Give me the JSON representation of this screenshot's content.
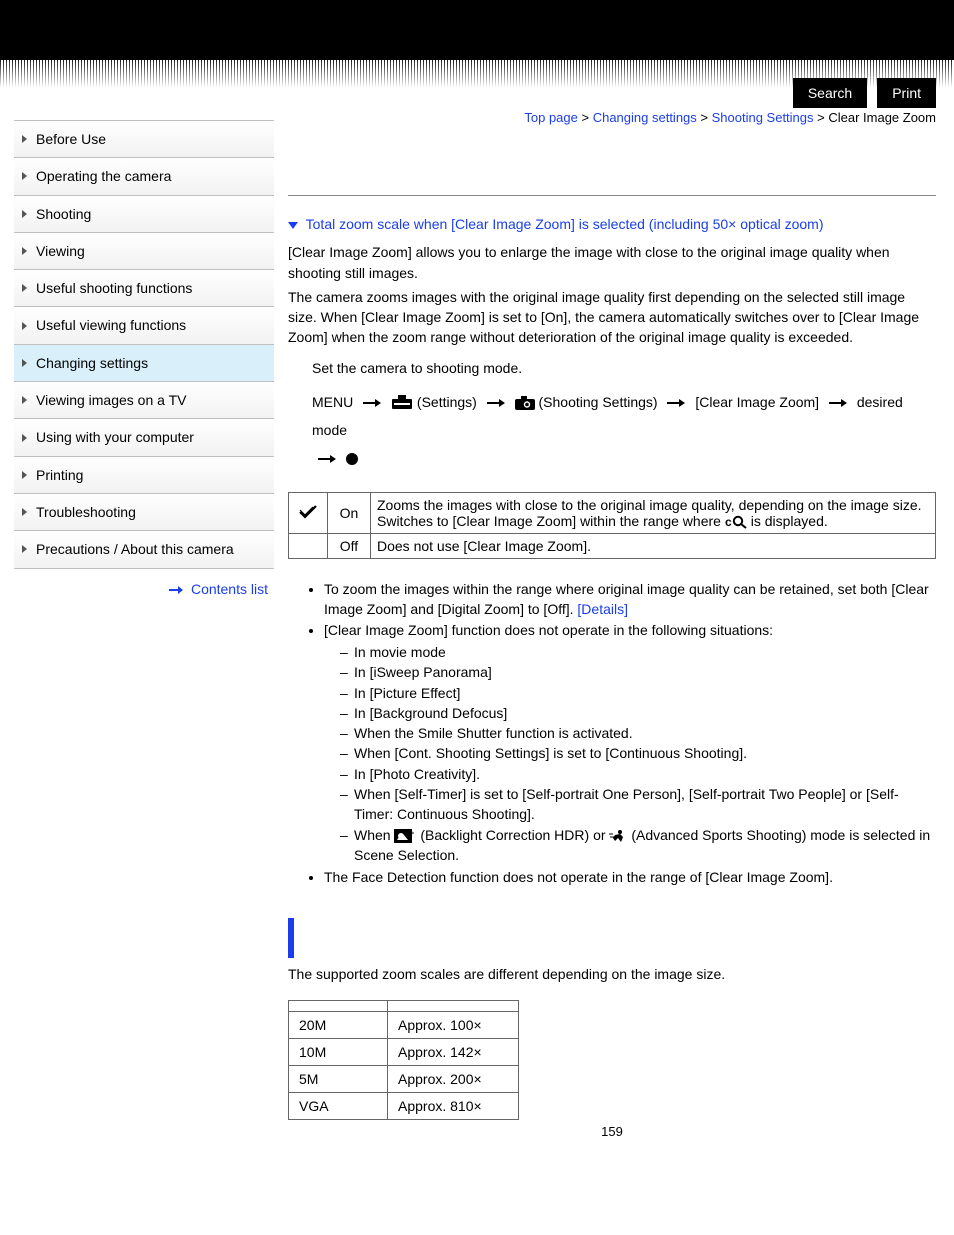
{
  "top_buttons": {
    "search": "Search",
    "print": "Print"
  },
  "sidebar": {
    "items": [
      {
        "label": "Before Use"
      },
      {
        "label": "Operating the camera"
      },
      {
        "label": "Shooting"
      },
      {
        "label": "Viewing"
      },
      {
        "label": "Useful shooting functions"
      },
      {
        "label": "Useful viewing functions"
      },
      {
        "label": "Changing settings",
        "active": true
      },
      {
        "label": "Viewing images on a TV"
      },
      {
        "label": "Using with your computer"
      },
      {
        "label": "Printing"
      },
      {
        "label": "Troubleshooting"
      },
      {
        "label": "Precautions / About this camera"
      }
    ],
    "contents_link": "Contents list"
  },
  "breadcrumb": {
    "top": "Top page",
    "l1": "Changing settings",
    "l2": "Shooting Settings",
    "current": "Clear Image Zoom",
    "sep": " > "
  },
  "anchor_heading": "Total zoom scale when [Clear Image Zoom] is selected (including 50× optical zoom)",
  "intro": {
    "p1": "[Clear Image Zoom] allows you to enlarge the image with close to the original image quality when shooting still images.",
    "p2": "The camera zooms images with the original image quality first depending on the selected still image size. When [Clear Image Zoom] is set to [On], the camera automatically switches over to [Clear Image Zoom] when the zoom range without deterioration of the original image quality is exceeded."
  },
  "steps": {
    "s1": "Set the camera to shooting mode.",
    "menu": "MENU",
    "settings": "(Settings)",
    "shooting": "(Shooting Settings)",
    "ciz": "[Clear Image Zoom]",
    "desired": "desired mode"
  },
  "option_table": {
    "on_label": "On",
    "on_desc_a": "Zooms the images with close to the original image quality, depending on the image size.",
    "on_desc_b1": "Switches to [Clear Image Zoom] within the range where ",
    "on_desc_b2": " is displayed.",
    "off_label": "Off",
    "off_desc": "Does not use [Clear Image Zoom]."
  },
  "notes": {
    "n1a": "To zoom the images within the range where original image quality can be retained, set both [Clear Image Zoom] and [Digital Zoom] to [Off]. ",
    "n1_link": "[Details]",
    "n2": "[Clear Image Zoom] function does not operate in the following situations:",
    "n2_sub": [
      "In movie mode",
      "In [iSweep Panorama]",
      "In [Picture Effect]",
      "In [Background Defocus]",
      "When the Smile Shutter function is activated.",
      "When [Cont. Shooting Settings] is set to [Continuous Shooting].",
      "In [Photo Creativity].",
      "When [Self-Timer] is set to [Self-portrait One Person], [Self-portrait Two People] or [Self-Timer: Continuous Shooting]."
    ],
    "n2_last_a": "When ",
    "n2_last_b": " (Backlight Correction HDR) or ",
    "n2_last_c": " (Advanced Sports Shooting) mode is selected in Scene Selection.",
    "n3": "The Face Detection function does not operate in the range of [Clear Image Zoom]."
  },
  "zoom_section": {
    "lead": "The supported zoom scales are different depending on the image size.",
    "rows": [
      {
        "size": "20M",
        "scale": "Approx. 100×"
      },
      {
        "size": "10M",
        "scale": "Approx. 142×"
      },
      {
        "size": "5M",
        "scale": "Approx. 200×"
      },
      {
        "size": "VGA",
        "scale": "Approx. 810×"
      }
    ]
  },
  "page_number": "159"
}
